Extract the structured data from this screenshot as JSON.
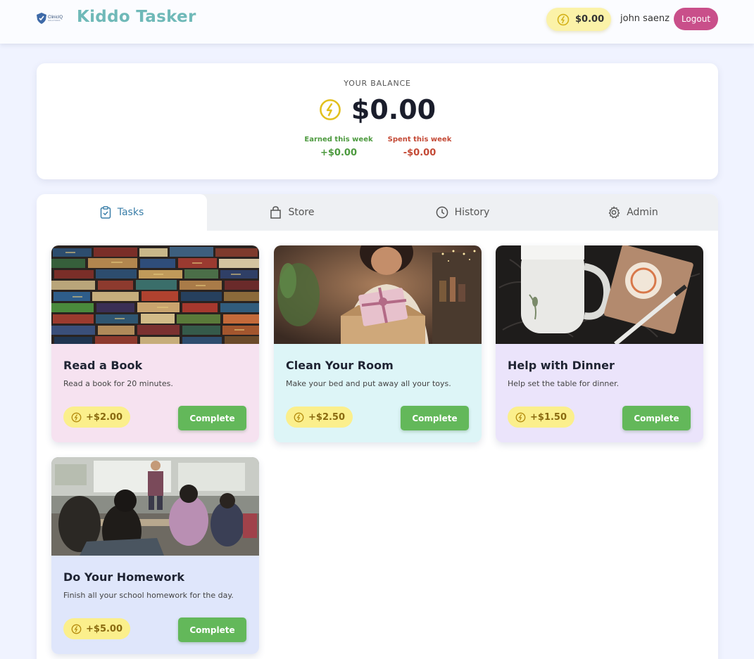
{
  "header": {
    "logo_name": "ClinicIQ",
    "logo_sub": "SOLUTIONS",
    "app_title": "Kiddo Tasker",
    "coin_balance": "$0.00",
    "username": "john saenz",
    "logout_label": "Logout"
  },
  "balance": {
    "label": "YOUR BALANCE",
    "amount": "$0.00",
    "earned_label": "Earned this week",
    "earned_value": "+$0.00",
    "spent_label": "Spent this week",
    "spent_value": "-$0.00"
  },
  "tabs": [
    {
      "label": "Tasks",
      "icon": "clipboard-check-icon",
      "active": true
    },
    {
      "label": "Store",
      "icon": "shopping-bag-icon",
      "active": false
    },
    {
      "label": "History",
      "icon": "clock-icon",
      "active": false
    },
    {
      "label": "Admin",
      "icon": "gear-icon",
      "active": false
    }
  ],
  "tasks": [
    {
      "title": "Read a Book",
      "description": "Read a book for 20 minutes.",
      "reward": "+$2.00",
      "button": "Complete",
      "color": "#f6e2f0"
    },
    {
      "title": "Clean Your Room",
      "description": "Make your bed and put away all your toys.",
      "reward": "+$2.50",
      "button": "Complete",
      "color": "#ddf5f7"
    },
    {
      "title": "Help with Dinner",
      "description": "Help set the table for dinner.",
      "reward": "+$1.50",
      "button": "Complete",
      "color": "#ebe4fb"
    },
    {
      "title": "Do Your Homework",
      "description": "Finish all your school homework for the day.",
      "reward": "+$5.00",
      "button": "Complete",
      "color": "#dfe6fb"
    }
  ],
  "colors": {
    "accent_teal": "#6fb9b8",
    "logout_pink": "#c94f8a",
    "coin_yellow": "#fbef8c",
    "complete_green": "#63b85a",
    "earned_green": "#4d9a3f",
    "spent_red": "#c44a36"
  }
}
